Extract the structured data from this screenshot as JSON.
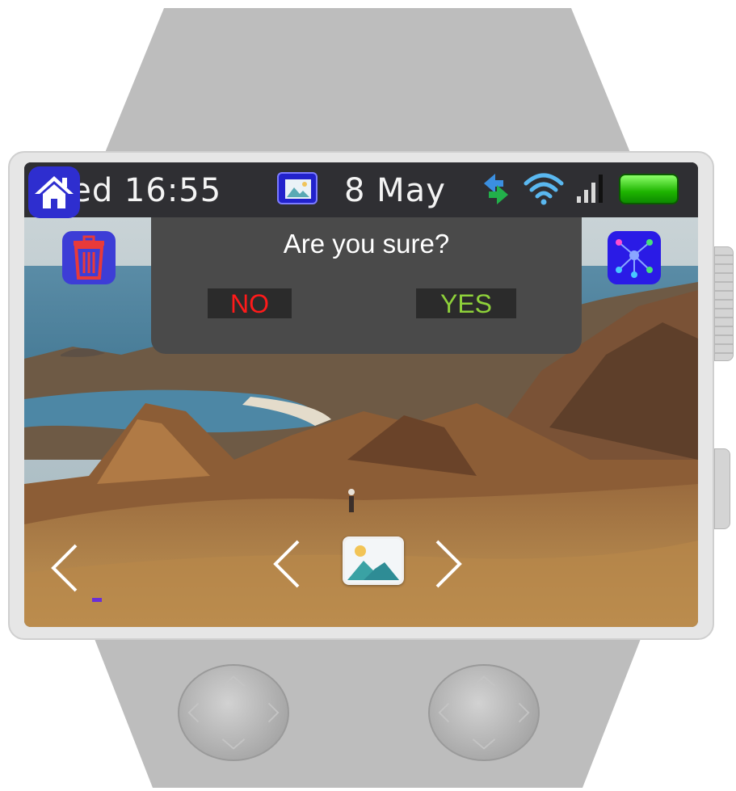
{
  "status_bar": {
    "day_time": "Wed 16:55",
    "date": "8 May",
    "icons": [
      "gallery-icon",
      "sync-icon",
      "wifi-icon",
      "signal-icon",
      "battery-icon"
    ]
  },
  "dialog": {
    "title": "Are you sure?",
    "no_label": "NO",
    "yes_label": "YES"
  },
  "buttons": {
    "trash": "trash-icon",
    "network": "network-icon",
    "home": "home-icon",
    "prev": "chevron-left-icon",
    "next": "chevron-right-icon",
    "gallery": "gallery-icon"
  },
  "colors": {
    "no": "#ff1a1a",
    "yes": "#8ed13a",
    "status_bar": "#2f2f33",
    "dialog": "#4a4a4a",
    "app_button": "#3d3dd6",
    "battery": "#1eb400"
  }
}
